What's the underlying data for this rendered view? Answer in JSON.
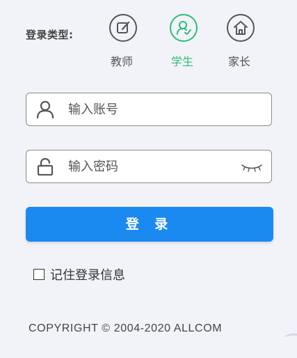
{
  "login_type": {
    "label": "登录类型:",
    "options": [
      {
        "label": "教师",
        "icon": "edit-icon"
      },
      {
        "label": "学生",
        "icon": "student-icon",
        "active": true
      },
      {
        "label": "家长",
        "icon": "home-icon"
      }
    ]
  },
  "account": {
    "placeholder": "输入账号",
    "icon": "user-icon"
  },
  "password": {
    "placeholder": "输入密码",
    "icon": "lock-icon",
    "toggle_icon": "eye-closed-icon"
  },
  "login_button": "登 录",
  "remember": {
    "label": "记住登录信息",
    "checked": false
  },
  "copyright": "COPYRIGHT © 2004-2020 ALLCOM",
  "colors": {
    "accent": "#1a8af0",
    "active": "#2bbf73",
    "background": "#f1f3f8"
  }
}
